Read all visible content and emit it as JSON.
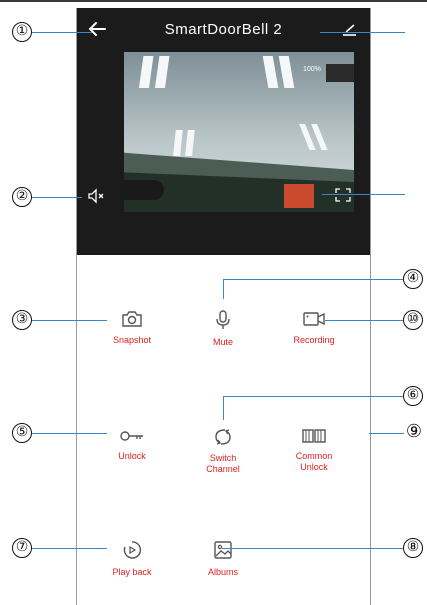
{
  "header": {
    "title": "SmartDoorBell 2"
  },
  "video": {
    "zoom": "100%"
  },
  "controls": [
    {
      "label": "Snapshot",
      "icon": "camera-icon"
    },
    {
      "label": "Mute",
      "icon": "microphone-icon"
    },
    {
      "label": "Recording",
      "icon": "video-camera-icon"
    },
    {
      "label": "Unlock",
      "icon": "key-icon"
    },
    {
      "label": "Switch\nChannel",
      "icon": "switch-channel-icon"
    },
    {
      "label": "Common\nUnlock",
      "icon": "double-door-icon"
    },
    {
      "label": "Play back",
      "icon": "playback-icon"
    },
    {
      "label": "Albums",
      "icon": "image-icon"
    }
  ],
  "callouts": {
    "c1": "①",
    "c2": "②",
    "c3": "③",
    "c4": "④",
    "c5": "⑤",
    "c6": "⑥",
    "c7": "⑦",
    "c8": "⑧",
    "c9": "⑨",
    "c10": "⑩"
  },
  "colors": {
    "accent": "#e02020",
    "header_bg": "#1b1b1b",
    "callout_line": "#3a86c8"
  }
}
